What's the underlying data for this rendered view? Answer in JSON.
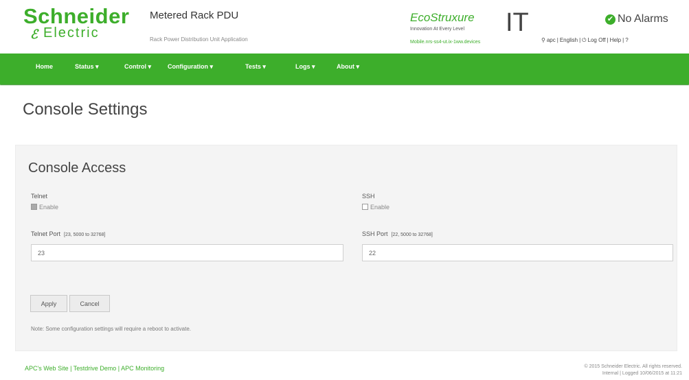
{
  "header": {
    "logo_main": "Schneider",
    "logo_sub": "Electric",
    "product_title": "Metered Rack PDU",
    "product_subtitle": "Rack Power Distribution Unit Application",
    "eco_title": "EcoStruxure",
    "eco_tagline": "Innovation At Every Level",
    "eco_link": "Mobile.nrs-ss4-ut.ix-1ww.devices",
    "eco_it": "IT",
    "alarm_status": "No Alarms",
    "user": "apc",
    "language": "English",
    "logoff": "Log Off",
    "help": "Help"
  },
  "nav": [
    {
      "label": "Home"
    },
    {
      "label": "Status ▾"
    },
    {
      "label": "Control ▾"
    },
    {
      "label": "Configuration ▾"
    },
    {
      "label": "Tests ▾"
    },
    {
      "label": "Logs ▾"
    },
    {
      "label": "About ▾"
    }
  ],
  "page_title": "Console Settings",
  "form": {
    "section_title": "Console Access",
    "telnet_label": "Telnet",
    "telnet_enable": "Enable",
    "telnet_enabled": true,
    "ssh_label": "SSH",
    "ssh_enable": "Enable",
    "ssh_enabled": false,
    "telnet_port_label": "Telnet Port",
    "telnet_port_range": "[23, 5000 to 32768]",
    "telnet_port_value": "23",
    "ssh_port_label": "SSH Port",
    "ssh_port_range": "[22, 5000 to 32768]",
    "ssh_port_value": "22",
    "apply": "Apply",
    "cancel": "Cancel",
    "note": "Note: Some configuration settings will require a reboot to activate."
  },
  "footer": {
    "links": "APC's Web Site | Testdrive Demo | APC Monitoring",
    "copyright": "© 2015 Schneider Electric. All rights reserved.",
    "session": "Internal | Logged 10/06/2015 at 11:21"
  },
  "colors": {
    "accent": "#3dae2b",
    "panel": "#f4f4f4"
  }
}
